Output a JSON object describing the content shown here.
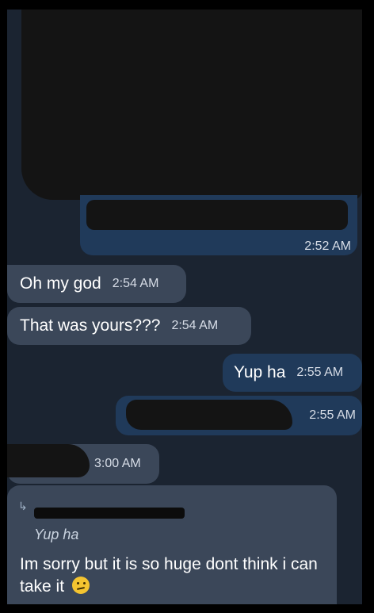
{
  "messages": [
    {
      "time": "2:52 AM"
    },
    {
      "text": "Oh my god",
      "time": "2:54 AM"
    },
    {
      "text": "That was yours???",
      "time": "2:54 AM"
    },
    {
      "text": "Yup ha",
      "time": "2:55 AM"
    },
    {
      "time": "2:55 AM"
    },
    {
      "time": "3:00 AM"
    }
  ],
  "reply": {
    "quoted_text": "Yup ha",
    "body": "Im sorry but it is so huge dont think i can take it",
    "emoji": "confused-face-icon"
  },
  "colors": {
    "background": "#1b2431",
    "incoming_bubble": "#3b4759",
    "outgoing_bubble": "#203a5a"
  }
}
